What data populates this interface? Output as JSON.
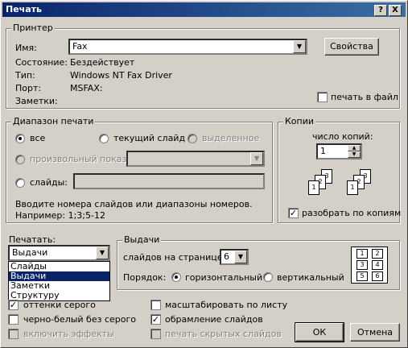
{
  "window": {
    "title": "Печать",
    "help_btn": "?",
    "close_btn": "X"
  },
  "printer": {
    "legend": "Принтер",
    "name_label": "Имя:",
    "name_value": "Fax",
    "properties_button": "Свойства",
    "status_label": "Состояние:",
    "status_value": "Бездействует",
    "type_label": "Тип:",
    "type_value": "Windows NT Fax Driver",
    "port_label": "Порт:",
    "port_value": "MSFAX:",
    "notes_label": "Заметки:",
    "print_to_file": "печать в файл"
  },
  "range": {
    "legend": "Диапазон печати",
    "all": "все",
    "current": "текущий слайд",
    "selection": "выделенное",
    "custom_show": "произвольный показ:",
    "slides": "слайды:",
    "hint1": "Вводите номера слайдов или диапазоны номеров.",
    "hint2": "Например: 1;3;5-12"
  },
  "copies": {
    "legend": "Копии",
    "count_label": "число копий:",
    "count_value": "1",
    "collate": "разобрать по копиям",
    "page_labels": [
      "1",
      "2",
      "3"
    ]
  },
  "print_what": {
    "label": "Печатать:",
    "value": "Выдачи",
    "options": [
      "Слайды",
      "Выдачи",
      "Заметки",
      "Структуру"
    ]
  },
  "handouts": {
    "legend": "Выдачи",
    "per_page_label": "слайдов на странице:",
    "per_page_value": "6",
    "order_label": "Порядок:",
    "horizontal": "горизонтальный",
    "vertical": "вертикальный",
    "preview_numbers": [
      "1",
      "2",
      "3",
      "4",
      "5",
      "6"
    ]
  },
  "options": {
    "grayscale": "оттенки серого",
    "pure_bw": "черно-белый без серого",
    "include_animations": "включить эффекты",
    "scale_to_fit": "масштабировать по листу",
    "frame_slides": "обрамление слайдов",
    "print_hidden": "печать скрытых слайдов"
  },
  "buttons": {
    "ok": "ОК",
    "cancel": "Отмена"
  }
}
